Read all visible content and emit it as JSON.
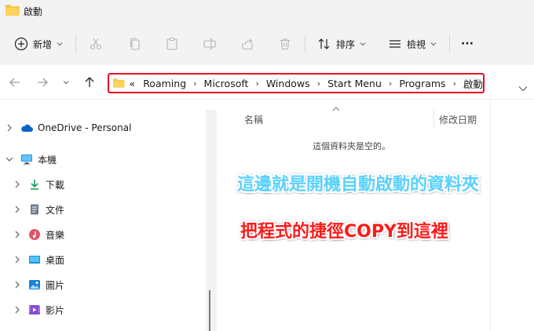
{
  "window": {
    "title": "啟動"
  },
  "toolbar": {
    "new_label": "新增",
    "sort_label": "排序",
    "view_label": "檢視",
    "more_label": "···"
  },
  "address": {
    "overflow": "«",
    "crumbs": [
      "Roaming",
      "Microsoft",
      "Windows",
      "Start Menu",
      "Programs",
      "啟動"
    ]
  },
  "sidebar": {
    "items": [
      {
        "label": "OneDrive - Personal"
      },
      {
        "label": "本機"
      },
      {
        "label": "下載"
      },
      {
        "label": "文件"
      },
      {
        "label": "音樂"
      },
      {
        "label": "桌面"
      },
      {
        "label": "圖片"
      },
      {
        "label": "影片"
      }
    ]
  },
  "content": {
    "col_name": "名稱",
    "col_modified": "修改日期",
    "empty_message": "這個資料夾是空的。"
  },
  "annotations": {
    "line1": "這邊就是開機自動啟動的資料夾",
    "line2": "把程式的捷徑COPY到這裡"
  },
  "colors": {
    "folder": "#f7c744",
    "highlight_border": "#e81123",
    "annotation_blue": "#5ad1ff",
    "annotation_red": "#ff1a1a"
  }
}
